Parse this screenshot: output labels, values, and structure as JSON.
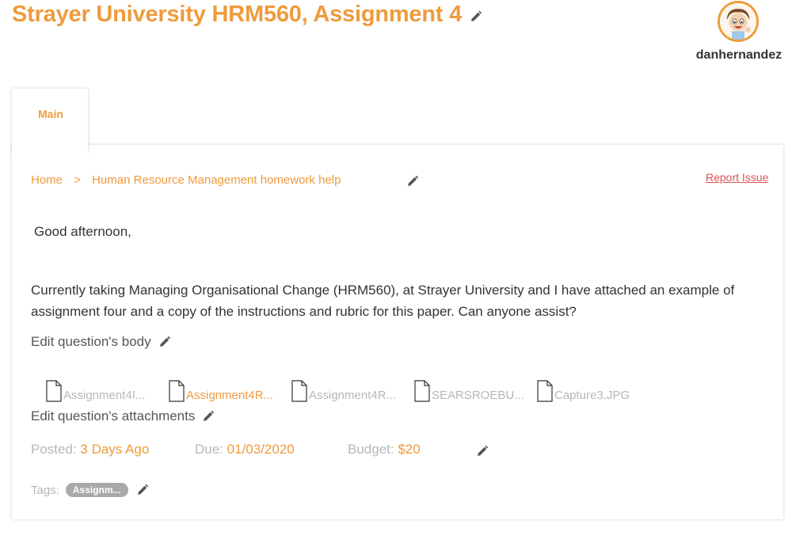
{
  "page": {
    "title": "Strayer University HRM560, Assignment 4"
  },
  "user": {
    "name": "danhernandez",
    "avatar_icon": "cartoon-boy-avatar"
  },
  "tabs": [
    {
      "label": "Main",
      "active": true
    }
  ],
  "breadcrumb": {
    "home": "Home",
    "separator": ">",
    "category": "Human Resource Management homework help"
  },
  "report_issue": "Report Issue",
  "question": {
    "greeting": "Good afternoon,",
    "body": "Currently taking Managing Organisational Change (HRM560), at Strayer University and I have attached an example of assignment four and a copy of the instructions and rubric for this paper. Can anyone assist?",
    "edit_body_label": "Edit question's body",
    "edit_attachments_label": "Edit question's attachments"
  },
  "attachments": [
    {
      "name": "Assignment4I...",
      "icon": "file-icon"
    },
    {
      "name": "Assignment4R...",
      "icon": "file-icon"
    },
    {
      "name": "Assignment4R...",
      "icon": "file-icon"
    },
    {
      "name": "SEARSROEBU...",
      "icon": "file-icon"
    },
    {
      "name": "Capture3.JPG",
      "icon": "file-icon"
    }
  ],
  "meta": {
    "posted_label": "Posted:",
    "posted_value": "3 Days Ago",
    "due_label": "Due:",
    "due_value": "01/03/2020",
    "budget_label": "Budget:",
    "budget_value": "$20"
  },
  "tags": {
    "label": "Tags:",
    "items": [
      "Assignm..."
    ]
  },
  "colors": {
    "accent": "#ee9b3c",
    "muted": "#b7b7b7",
    "report": "#d9534f",
    "tag_bg": "#a9a9a9"
  }
}
